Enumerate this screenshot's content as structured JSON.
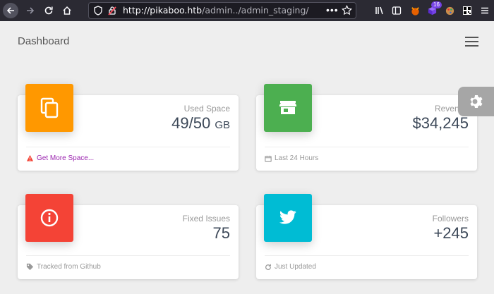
{
  "browser": {
    "url_host": "http://pikaboo.htb",
    "url_path": "/admin../admin_staging/",
    "url_menu": "•••",
    "extension_badge": "16"
  },
  "page": {
    "title": "Dashboard"
  },
  "cards": [
    {
      "category": "Used Space",
      "value": "49/50",
      "unit": "GB",
      "footer": "Get More Space...",
      "color": "#ff9800"
    },
    {
      "category": "Revenue",
      "value": "$34,245",
      "footer": "Last 24 Hours",
      "color": "#4caf50"
    },
    {
      "category": "Fixed Issues",
      "value": "75",
      "footer": "Tracked from Github",
      "color": "#f44336"
    },
    {
      "category": "Followers",
      "value": "+245",
      "footer": "Just Updated",
      "color": "#00bcd4"
    }
  ],
  "colors": {
    "warning": "#f44336",
    "link": "#9c27b0"
  }
}
